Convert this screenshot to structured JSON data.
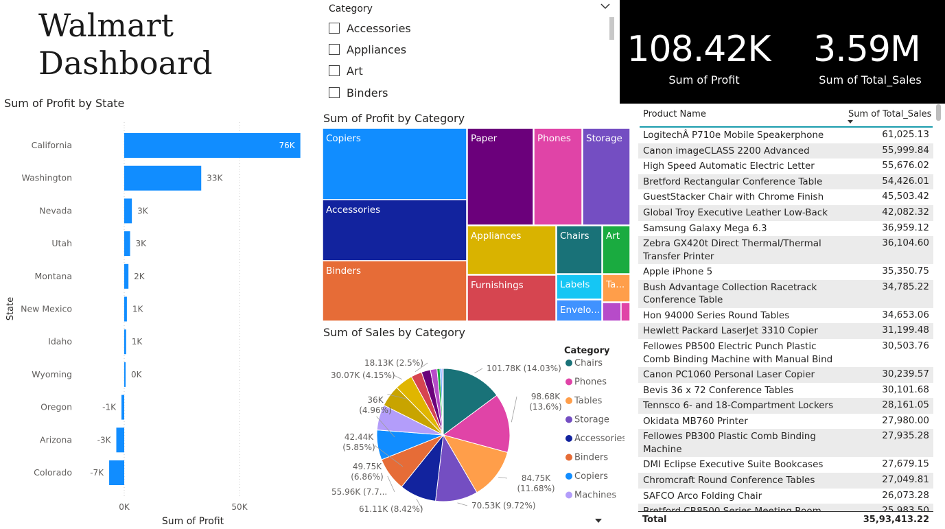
{
  "dashboard_title": "Walmart Dashboard",
  "slicer": {
    "title": "Category",
    "items": [
      "Accessories",
      "Appliances",
      "Art",
      "Binders"
    ]
  },
  "kpis": [
    {
      "value": "108.42K",
      "label": "Sum of Profit"
    },
    {
      "value": "3.59M",
      "label": "Sum of Total_Sales"
    }
  ],
  "table": {
    "col1": "Product Name",
    "col2": "Sum of Total_Sales",
    "rows": [
      {
        "name": "LogitechÂ P710e Mobile Speakerphone",
        "value": "61,025.13"
      },
      {
        "name": "Canon imageCLASS 2200 Advanced Copier",
        "value": "55,999.84"
      },
      {
        "name": "High Speed Automatic Electric Letter Opener",
        "value": "55,676.02"
      },
      {
        "name": "Bretford Rectangular Conference Table Tops",
        "value": "54,426.01"
      },
      {
        "name": "GuestStacker Chair with Chrome Finish Legs",
        "value": "45,503.42"
      },
      {
        "name": "Global Troy Executive Leather Low-Back Tilter",
        "value": "42,082.32"
      },
      {
        "name": "Samsung Galaxy Mega 6.3",
        "value": "36,959.12"
      },
      {
        "name": "Zebra GX420t Direct Thermal/Thermal Transfer Printer",
        "value": "36,104.60"
      },
      {
        "name": "Apple iPhone 5",
        "value": "35,350.75"
      },
      {
        "name": "Bush Advantage Collection Racetrack Conference Table",
        "value": "34,785.22"
      },
      {
        "name": "Hon 94000 Series Round Tables",
        "value": "34,653.06"
      },
      {
        "name": "Hewlett Packard LaserJet 3310 Copier",
        "value": "31,199.48"
      },
      {
        "name": "Fellowes PB500 Electric Punch Plastic Comb Binding Machine with Manual Bind",
        "value": "30,503.76"
      },
      {
        "name": "Canon PC1060 Personal Laser Copier",
        "value": "30,239.57"
      },
      {
        "name": "Bevis 36 x 72 Conference Tables",
        "value": "30,101.68"
      },
      {
        "name": "Tennsco 6- and 18-Compartment Lockers",
        "value": "28,161.05"
      },
      {
        "name": "Okidata MB760 Printer",
        "value": "27,980.00"
      },
      {
        "name": "Fellowes PB300 Plastic Comb Binding Machine",
        "value": "27,935.28"
      },
      {
        "name": "DMI Eclipse Executive Suite Bookcases",
        "value": "27,679.15"
      },
      {
        "name": "Chromcraft Round Conference Tables",
        "value": "27,049.81"
      },
      {
        "name": "SAFCO Arco Folding Chair",
        "value": "26,073.28"
      },
      {
        "name": "Bretford CR8500 Series Meeting Room",
        "value": "25,983.50"
      }
    ],
    "total_label": "Total",
    "total_value": "35,93,413.22"
  },
  "chart_data": [
    {
      "type": "bar",
      "orientation": "horizontal",
      "title": "Sum of Profit by State",
      "xlabel": "Sum of Profit",
      "ylabel": "State",
      "categories": [
        "California",
        "Washington",
        "Nevada",
        "Utah",
        "Montana",
        "New Mexico",
        "Idaho",
        "Wyoming",
        "Oregon",
        "Arizona",
        "Colorado"
      ],
      "values": [
        76381,
        33403,
        3317,
        2547,
        1834,
        1158,
        827,
        100,
        -1191,
        -3428,
        -6528
      ],
      "data_labels": [
        "76K",
        "33K",
        "3K",
        "3K",
        "2K",
        "1K",
        "1K",
        "0K",
        "-1K",
        "-3K",
        "-7K"
      ],
      "xticks": [
        "0K",
        "50K"
      ],
      "xlim": [
        -7000,
        76381
      ],
      "grid": true,
      "color": "#118DFF"
    },
    {
      "type": "treemap",
      "title": "Sum of Profit by Category",
      "categories": [
        "Copiers",
        "Accessories",
        "Binders",
        "Paper",
        "Phones",
        "Storage",
        "Appliances",
        "Furnishings",
        "Chairs",
        "Art",
        "Labels",
        "Ta...",
        "Envelo..."
      ],
      "values": [
        26000,
        17000,
        13500,
        9500,
        8000,
        7200,
        5400,
        4500,
        3600,
        2200,
        1900,
        1200,
        1500
      ],
      "colors": [
        "#118DFF",
        "#12239E",
        "#E66C37",
        "#6B007B",
        "#E044A7",
        "#744EC2",
        "#D9B300",
        "#D64550",
        "#197278",
        "#1AAB40",
        "#15C6F4",
        "#FF9E4A",
        "#4092FF"
      ]
    },
    {
      "type": "pie",
      "title": "Sum of Sales by Category",
      "legend_title": "Category",
      "legend": [
        "Chairs",
        "Phones",
        "Tables",
        "Storage",
        "Accessories",
        "Binders",
        "Copiers",
        "Machines"
      ],
      "slices": [
        {
          "name": "Chairs",
          "value": 101.78,
          "label": "101.78K (14.03%)",
          "color": "#197278"
        },
        {
          "name": "Phones",
          "value": 98.68,
          "label": "98.68K (13.6%)",
          "color": "#E044A7"
        },
        {
          "name": "Tables",
          "value": 84.75,
          "label": "84.75K (11.68%)",
          "color": "#FF9E4A"
        },
        {
          "name": "Storage",
          "value": 70.53,
          "label": "70.53K (9.72%)",
          "color": "#744EC2"
        },
        {
          "name": "Accessories",
          "value": 61.11,
          "label": "61.11K (8.42%)",
          "color": "#12239E"
        },
        {
          "name": "Binders",
          "value": 55.96,
          "label": "55.96K (7.7...",
          "color": "#E66C37"
        },
        {
          "name": "Copiers",
          "value": 49.75,
          "label": "49.75K (6.86%)",
          "color": "#118DFF"
        },
        {
          "name": "Machines",
          "value": 42.44,
          "label": "42.44K (5.85%)",
          "color": "#B39DFA"
        },
        {
          "name": "s9",
          "value": 36.0,
          "label": "36K (4.96%)",
          "color": "#C8A400"
        },
        {
          "name": "s10",
          "value": 30.07,
          "label": "30.07K (4.15%)",
          "color": "#E0B600"
        },
        {
          "name": "s11",
          "value": 18.13,
          "label": "18.13K (2.5%)",
          "color": "#D64550"
        },
        {
          "name": "s12",
          "value": 15.0,
          "label": "",
          "color": "#6B007B"
        },
        {
          "name": "s13",
          "value": 11.0,
          "label": "",
          "color": "#B74BC9"
        },
        {
          "name": "s14",
          "value": 5.0,
          "label": "",
          "color": "#1AAB40"
        },
        {
          "name": "s15",
          "value": 3.0,
          "label": "",
          "color": "#4092FF"
        },
        {
          "name": "s16",
          "value": 2.5,
          "label": "",
          "color": "#B39DFA"
        }
      ]
    }
  ]
}
